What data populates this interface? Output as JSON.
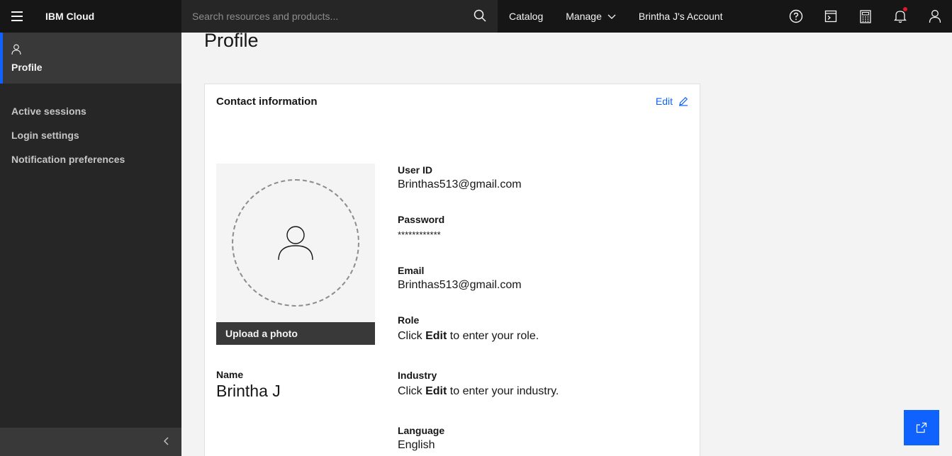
{
  "header": {
    "brand": "IBM Cloud",
    "search_placeholder": "Search resources and products...",
    "nav": {
      "catalog": "Catalog",
      "manage": "Manage",
      "account": "Brintha J's Account"
    }
  },
  "sidebar": {
    "active": "Profile",
    "items": [
      "Active sessions",
      "Login settings",
      "Notification preferences"
    ]
  },
  "main": {
    "title": "Profile",
    "card": {
      "title": "Contact information",
      "edit": "Edit",
      "upload": "Upload a photo",
      "name_label": "Name",
      "name_value": "Brintha J",
      "fields": {
        "user_id": {
          "label": "User ID",
          "value": "Brinthas513@gmail.com"
        },
        "password": {
          "label": "Password",
          "value": "************"
        },
        "email": {
          "label": "Email",
          "value": "Brinthas513@gmail.com"
        },
        "role": {
          "label": "Role",
          "pre": "Click ",
          "bold": "Edit",
          "post": " to enter your role."
        },
        "industry": {
          "label": "Industry",
          "pre": "Click ",
          "bold": "Edit",
          "post": " to enter your industry."
        },
        "language": {
          "label": "Language",
          "value": "English"
        }
      }
    }
  },
  "colors": {
    "accent": "#0f62fe",
    "topbar": "#161616",
    "sidebar": "#262626",
    "notification": "#da1e28"
  }
}
